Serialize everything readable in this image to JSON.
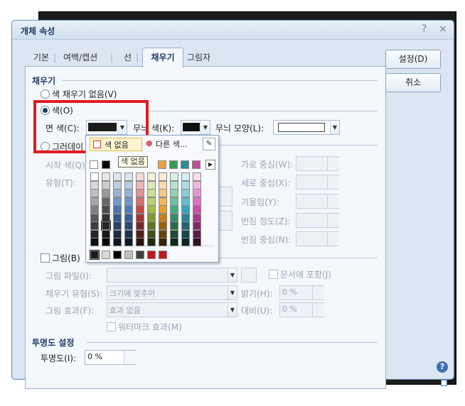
{
  "dialog": {
    "title": "개체 속성",
    "help_glyph": "?",
    "close_glyph": "×"
  },
  "tabs": [
    {
      "label": "기본"
    },
    {
      "label": "여백/캡션"
    },
    {
      "label": "선"
    },
    {
      "label": "채우기"
    },
    {
      "label": "그림자"
    }
  ],
  "buttons": {
    "ok": "설정(D)",
    "cancel": "취소"
  },
  "fill": {
    "section_title": "채우기",
    "no_fill": "색 채우기 없음(V)",
    "color": "색(O)",
    "face_color_label": "면 색(C):",
    "pattern_color_label": "무늬 색(K):",
    "pattern_shape_label": "무늬 모양(L):",
    "gradient": "그러데이",
    "start_color_label": "시작 색(Q)",
    "type_label": "유형(T):",
    "h_center": "가로 중심(W):",
    "v_center": "세로 중심(X):",
    "slope": "기울임(Y):",
    "spread": "번짐 정도(Z):",
    "spread_center": "번짐 중심(N):"
  },
  "picture": {
    "label": "그림(B)",
    "file_label": "그림 파일(I):",
    "include_doc": "문서에 포함(J)",
    "fill_type_label": "채우기 유형(S):",
    "fill_type_value": "크기에 맞추어",
    "brightness_label": "밝기(H):",
    "brightness_value": "0 %",
    "effect_label": "그림 효과(F):",
    "effect_value": "효과 없음",
    "contrast_label": "대비(U):",
    "contrast_value": "0 %",
    "watermark": "워터마크 효과(M)"
  },
  "transparency": {
    "section_title": "투명도 설정",
    "label": "투명도(I):",
    "value": "0 %"
  },
  "palette": {
    "no_color": "색 없음",
    "other_colors": "다른 색...",
    "tooltip": "색 없음",
    "top_row": [
      "#ffffff",
      "#000000"
    ],
    "theme_row": [
      "#e8a33c",
      "#3a9a5c",
      "#2c8a9a",
      "#c04c9c"
    ],
    "columns": [
      [
        "#ffffff",
        "#d9d9d9",
        "#bfbfbf",
        "#a6a6a6",
        "#7f7f7f",
        "#595959",
        "#3f3f3f",
        "#262626",
        "#0d0d0d"
      ],
      [
        "#e7e7e7",
        "#cccccc",
        "#999999",
        "#666666",
        "#4d4d4d",
        "#333333",
        "#262626",
        "#1a1a1a",
        "#000000"
      ],
      [
        "#dde6f0",
        "#bbcde1",
        "#98b3d2",
        "#7698c3",
        "#4f74a8",
        "#3b5a86",
        "#2b4262",
        "#1d2c42",
        "#0e1621"
      ],
      [
        "#dbe5f2",
        "#b7cbe5",
        "#93b1d8",
        "#6f97cb",
        "#4b7dbe",
        "#36619c",
        "#294a77",
        "#1c3351",
        "#0e192a"
      ],
      [
        "#f5dbdb",
        "#ebb7b7",
        "#e19393",
        "#d76f6f",
        "#c84848",
        "#a53535",
        "#7d2828",
        "#561c1c",
        "#2e0f0f"
      ],
      [
        "#eef3dc",
        "#dde7b9",
        "#ccdb96",
        "#bbcf73",
        "#a4bb4a",
        "#839a34",
        "#637527",
        "#43501a",
        "#232a0e"
      ],
      [
        "#fcedd6",
        "#f9dbad",
        "#f6c984",
        "#f3b75b",
        "#ef9f28",
        "#c97f13",
        "#99600e",
        "#68420a",
        "#372305"
      ],
      [
        "#daf0e6",
        "#b5e1cd",
        "#90d2b4",
        "#6bc39b",
        "#43b07c",
        "#348e61",
        "#276c4a",
        "#1b4a33",
        "#0e271b"
      ],
      [
        "#d8eef2",
        "#b1dde5",
        "#8accd8",
        "#63bbcb",
        "#38a5b8",
        "#2a8594",
        "#206570",
        "#16454c",
        "#0b2428"
      ],
      [
        "#f6dcef",
        "#edb9df",
        "#e496cf",
        "#db73bf",
        "#cf4aab",
        "#ac368a",
        "#832968",
        "#5a1c47",
        "#301026"
      ]
    ],
    "recent": [
      "#1c1c1c",
      "#d9d9d9",
      "#000000",
      "#bfbfbf",
      "#404040",
      "#c0191e",
      "#c0191e"
    ]
  }
}
